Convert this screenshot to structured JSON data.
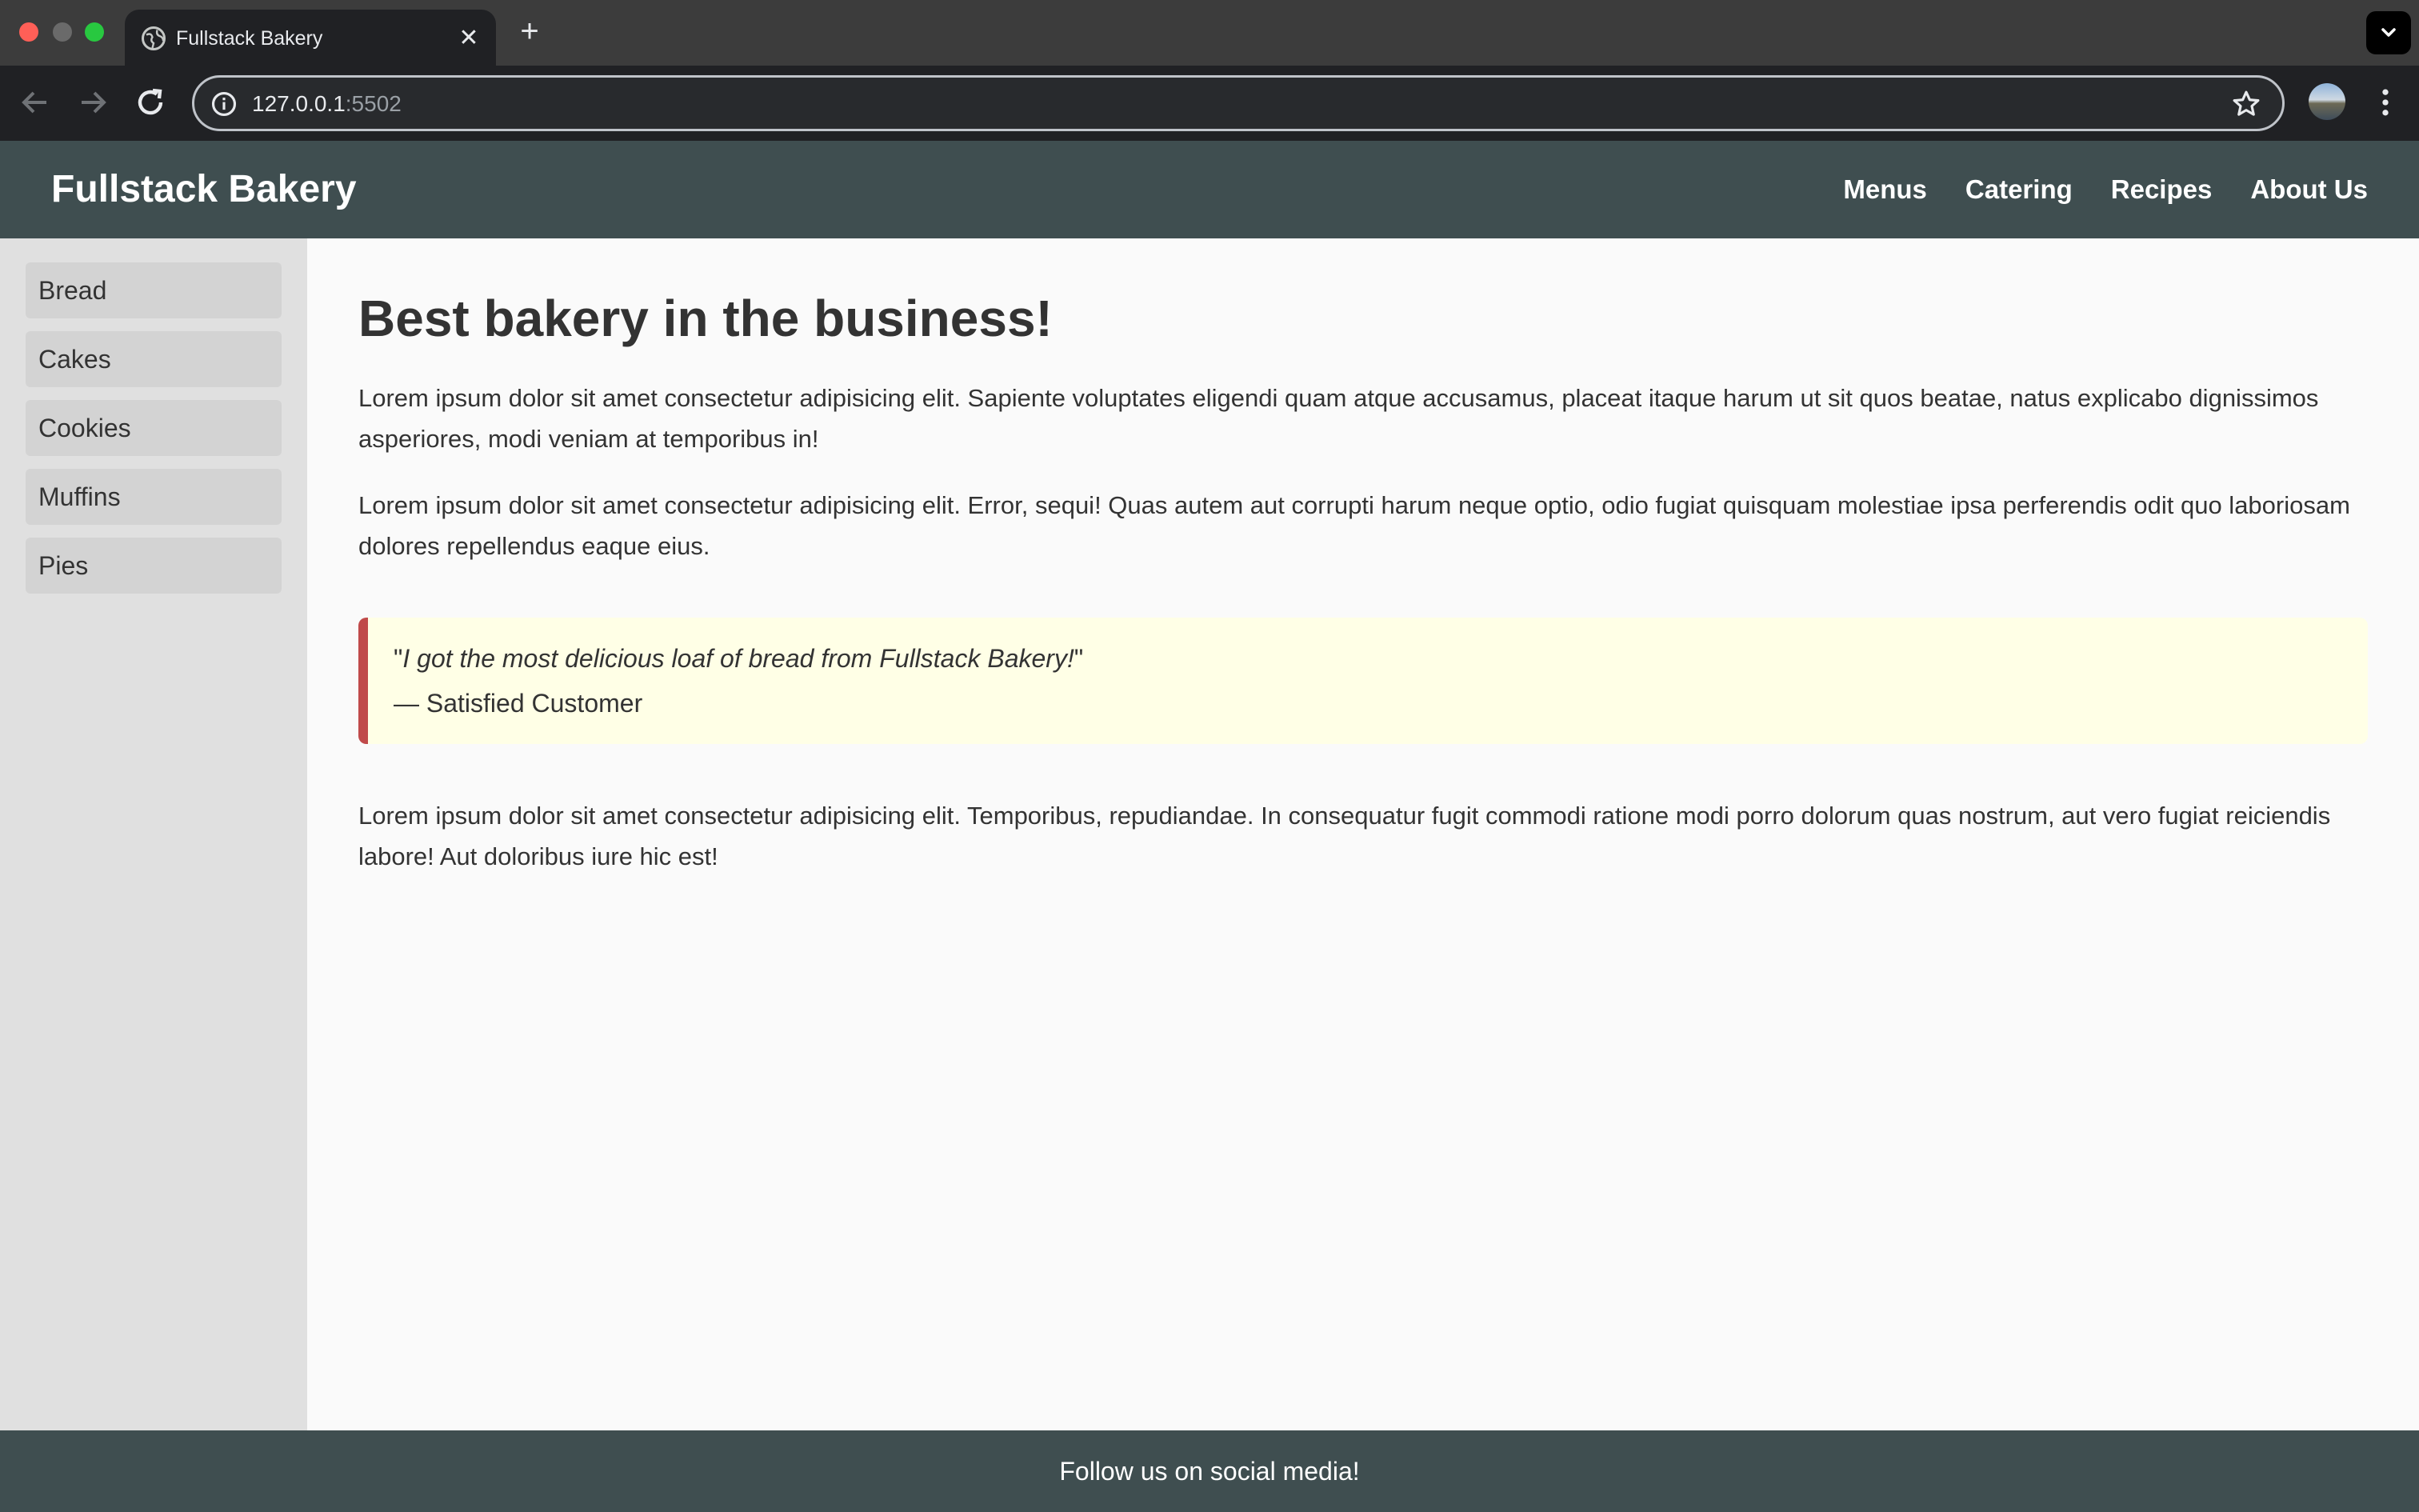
{
  "browser": {
    "tab_title": "Fullstack Bakery",
    "url_host": "127.0.0.1",
    "url_port": ":5502"
  },
  "site": {
    "brand": "Fullstack Bakery",
    "nav": [
      "Menus",
      "Catering",
      "Recipes",
      "About Us"
    ],
    "sidebar": [
      "Bread",
      "Cakes",
      "Cookies",
      "Muffins",
      "Pies"
    ],
    "main": {
      "headline": "Best bakery in the business!",
      "paragraphs": [
        "Lorem ipsum dolor sit amet consectetur adipisicing elit. Sapiente voluptates eligendi quam atque accusamus, placeat itaque harum ut sit quos beatae, natus explicabo dignissimos asperiores, modi veniam at temporibus in!",
        "Lorem ipsum dolor sit amet consectetur adipisicing elit. Error, sequi! Quas autem aut corrupti harum neque optio, odio fugiat quisquam molestiae ipsa perferendis odit quo laboriosam dolores repellendus eaque eius.",
        "Lorem ipsum dolor sit amet consectetur adipisicing elit. Temporibus, repudiandae. In consequatur fugit commodi ratione modi porro dolorum quas nostrum, aut vero fugiat reiciendis labore! Aut doloribus iure hic est!"
      ],
      "quote": {
        "open_mark": "\"",
        "text": "I got the most delicious loaf of bread from Fullstack Bakery!",
        "close_mark": "\"",
        "author": "— Satisfied Customer"
      }
    },
    "footer": "Follow us on social media!"
  },
  "colors": {
    "header_bg": "#3f4e50",
    "sidebar_bg": "#e0e0e0",
    "sidebar_item_bg": "#d3d3d3",
    "quote_bg": "#ffffe6",
    "quote_border": "#c04a4a",
    "page_bg": "#fafafa"
  },
  "icons": [
    "globe-icon",
    "close-icon",
    "plus-icon",
    "chevron-down-icon",
    "back-arrow-icon",
    "forward-arrow-icon",
    "reload-icon",
    "info-icon",
    "star-icon",
    "profile-avatar",
    "kebab-menu-icon"
  ]
}
